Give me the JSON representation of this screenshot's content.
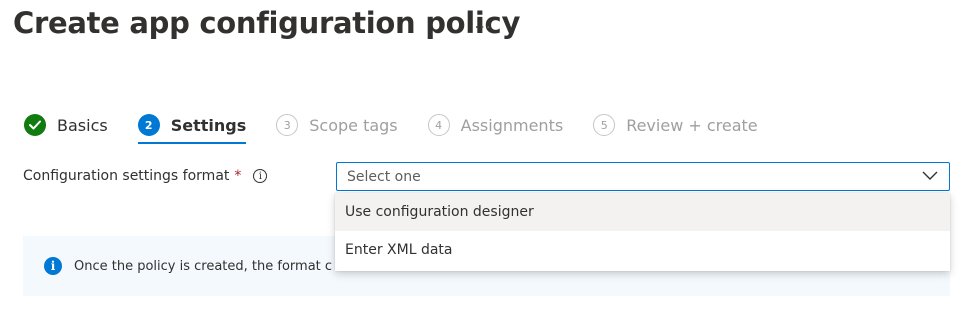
{
  "header": {
    "title": "Create app configuration policy",
    "more_label": "..."
  },
  "wizard": {
    "steps": [
      {
        "number": "",
        "label": "Basics",
        "state": "completed"
      },
      {
        "number": "2",
        "label": "Settings",
        "state": "current"
      },
      {
        "number": "3",
        "label": "Scope tags",
        "state": "upcoming"
      },
      {
        "number": "4",
        "label": "Assignments",
        "state": "upcoming"
      },
      {
        "number": "5",
        "label": "Review + create",
        "state": "upcoming"
      }
    ]
  },
  "form": {
    "format_field": {
      "label": "Configuration settings format",
      "required_mark": "*",
      "info_icon": "info-icon",
      "placeholder": "Select one",
      "options": [
        "Use configuration designer",
        "Enter XML data"
      ]
    }
  },
  "info_bar": {
    "text": "Once the policy is created, the format c",
    "icon": "info-icon"
  },
  "colors": {
    "accent": "#0078d4",
    "success": "#107c10",
    "required": "#a4262c",
    "info_background": "#f3f9fd"
  }
}
